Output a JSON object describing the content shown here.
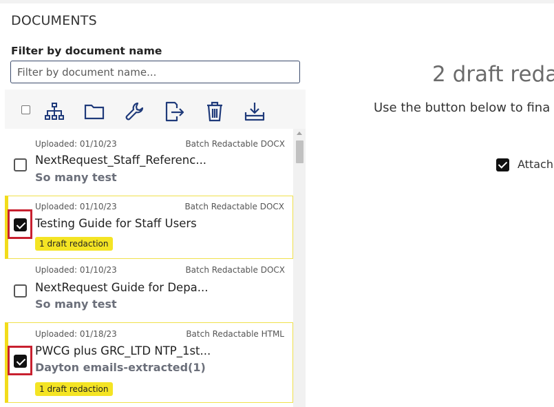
{
  "documents_panel": {
    "title": "DOCUMENTS",
    "filter_label": "Filter by document name",
    "filter_placeholder": "Filter by document name...",
    "filter_value": "",
    "toolbar_icons": [
      "sitemap-icon",
      "folder-icon",
      "wrench-icon",
      "export-icon",
      "trash-icon",
      "download-icon"
    ]
  },
  "documents": [
    {
      "uploaded": "Uploaded: 01/10/23",
      "type": "Batch Redactable DOCX",
      "name": "NextRequest_Staff_Referenc...",
      "subtitle": "So many test",
      "badge": "",
      "checked": false
    },
    {
      "uploaded": "Uploaded: 01/10/23",
      "type": "Batch Redactable DOCX",
      "name": "Testing Guide for Staff Users",
      "subtitle": "",
      "badge": "1 draft redaction",
      "checked": true
    },
    {
      "uploaded": "Uploaded: 01/10/23",
      "type": "Batch Redactable DOCX",
      "name": "NextRequest Guide for Depa...",
      "subtitle": "So many test",
      "badge": "",
      "checked": false
    },
    {
      "uploaded": "Uploaded: 01/18/23",
      "type": "Batch Redactable HTML",
      "name": "PWCG plus GRC_LTD NTP_1st...",
      "subtitle": "Dayton emails-extracted(1)",
      "badge": "1 draft redaction",
      "checked": true
    }
  ],
  "right_panel": {
    "heading": "2 draft reda",
    "description": "Use the button below to fina",
    "attach_label": "Attach",
    "attach_checked": true
  },
  "colors": {
    "accent_navy": "#1f3a7a",
    "selected_border": "#f2dc1b",
    "badge_bg": "#f4e424",
    "highlight_outline": "#c8202f"
  }
}
